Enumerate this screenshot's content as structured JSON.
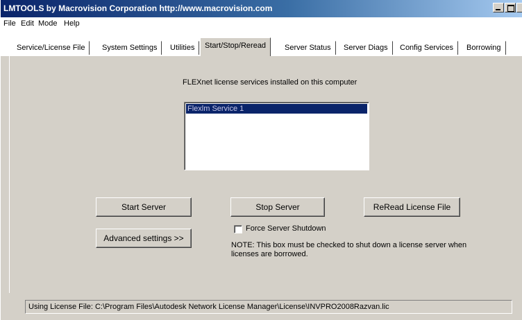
{
  "window": {
    "title": "LMTOOLS by Macrovision Corporation http://www.macrovision.com"
  },
  "menu": [
    "File",
    "Edit",
    "Mode",
    "Help"
  ],
  "tabs": [
    {
      "label": "Service/License File",
      "active": false
    },
    {
      "label": "System Settings",
      "active": false
    },
    {
      "label": "Utilities",
      "active": false
    },
    {
      "label": "Start/Stop/Reread",
      "active": true
    },
    {
      "label": "Server Status",
      "active": false
    },
    {
      "label": "Server Diags",
      "active": false
    },
    {
      "label": "Config Services",
      "active": false
    },
    {
      "label": "Borrowing",
      "active": false
    }
  ],
  "main": {
    "services_label": "FLEXnet license services installed on this computer",
    "services": [
      {
        "name": "Flexlm Service 1",
        "selected": true
      }
    ],
    "start_button": "Start Server",
    "stop_button": "Stop Server",
    "reread_button": "ReRead License File",
    "advanced_button": "Advanced settings >>",
    "force_shutdown": {
      "label": "Force Server Shutdown",
      "checked": false
    },
    "note": "NOTE:  This box must be checked to shut down a license server when licenses are borrowed."
  },
  "status": {
    "text": "Using License File:  C:\\Program Files\\Autodesk Network License Manager\\License\\INVPRO2008Razvan.lic"
  }
}
